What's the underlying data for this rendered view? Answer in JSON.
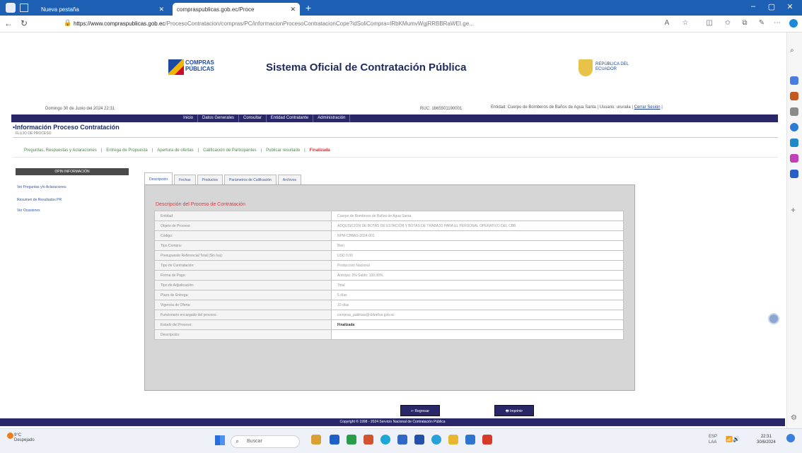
{
  "browser": {
    "tabs": [
      {
        "label": "Nueva pestaña"
      },
      {
        "label": "compraspublicas.gob.ec/Proce"
      }
    ],
    "url_host": "https://www.compraspublicas.gob.ec",
    "url_rest": "/ProcesoContratacion/compras/PC/informacionProcesoContratacionCope?idSoliCompra=IRbKMumvWgjRRBBRaWEI.ge..."
  },
  "header": {
    "logo_text": "COMPRAS PÚBLICAS",
    "title": "Sistema Oficial de Contratación Pública",
    "country_text": "REPÚBLICA DEL ECUADOR",
    "date": "Domingo 30 de Junio del 2024 22:31",
    "ruc": "RUC: 1865501190001",
    "entity": "Entidad: Cuerpo de Bomberos de Baños de Agua Santa",
    "user": "Usuario: ururaila",
    "user_link": "Cerrar Sesión"
  },
  "nav": [
    "Inicio",
    "Datos Generales",
    "Consultar",
    "Entidad Contratante",
    "Administración"
  ],
  "process": {
    "title": "Información Proceso Contratación",
    "subtitle": "FLUJO DE PROCESO",
    "steps": [
      "Preguntas, Respuestas y Aclaraciones",
      "Entrega de Propuesta",
      "Apertura de ofertas",
      "Calificación de Participantes",
      "Publicar resultado"
    ],
    "current_step": "Finalizada"
  },
  "left_menu": {
    "header": "OPIN INFORMACIÓN",
    "links": [
      "Ver Preguntas y/o Aclaraciones",
      "Resumen de Resultados PR",
      "Ver Ocasiones"
    ]
  },
  "tabs": [
    "Descripción",
    "Fechas",
    "Productos",
    "Parámetros de Calificación",
    "Archivos"
  ],
  "description": {
    "title": "Descripción del Proceso de Contratación",
    "rows": [
      {
        "label": "Entidad:",
        "value": "Cuerpo de Bomberos de Baños de Agua Santa"
      },
      {
        "label": "Objeto de Proceso:",
        "value": "ADQUISICIÓN DE BOTAS DE ESTACIÓN Y BOTAS DE TRABAJO PARA EL PERSONAL OPERATIVO DEL CBB"
      },
      {
        "label": "Código:",
        "value": "NPM-CBBAS-2024-001"
      },
      {
        "label": "Tipo Compra:",
        "value": "Bien"
      },
      {
        "label": "Presupuesto Referencial Total (Sin Iva):",
        "value": "USD 0.00"
      },
      {
        "label": "Tipo de Contratación:",
        "value": "Producción Nacional"
      },
      {
        "label": "Forma de Pago:",
        "value": "Anticipo: 0% Saldo: 100.00%"
      },
      {
        "label": "Tipo de Adjudicación:",
        "value": "Total"
      },
      {
        "label": "Plazo de Entrega:",
        "value": "5 días"
      },
      {
        "label": "Vigencia de Oferta:",
        "value": "10 días"
      },
      {
        "label": "Funcionario encargado del proceso:",
        "value": "compras_publicas@cbbaños.gob.ec"
      },
      {
        "label": "Estado del Proceso:",
        "value": "Finalizada",
        "bold": true
      },
      {
        "label": "Descripción:",
        "value": ""
      }
    ]
  },
  "buttons": {
    "back": "Regresar",
    "print": "Imprimir"
  },
  "footer": "Copyright © 1998 - 2024 Servicio Nacional de Contratación Pública",
  "taskbar": {
    "weather_temp": "9°C",
    "weather_desc": "Despejado",
    "search_placeholder": "Buscar",
    "lang1": "ESP",
    "lang2": "LAA",
    "time": "22:31",
    "date": "30/6/2024"
  },
  "colors": {
    "nav_bg": "#2a2769",
    "title_red": "#d04040",
    "taskbar_bg": "#eef2f8"
  }
}
